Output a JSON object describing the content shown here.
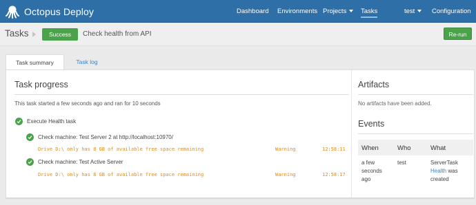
{
  "topbar": {
    "brand": "Octopus Deploy",
    "nav": {
      "dashboard": "Dashboard",
      "environments": "Environments",
      "projects": "Projects",
      "tasks": "Tasks",
      "user": "test",
      "configuration": "Configuration"
    }
  },
  "subheader": {
    "title": "Tasks",
    "status": "Success",
    "task_name": "Check health from API",
    "rerun_label": "Re-run"
  },
  "tabs": {
    "summary": "Task summary",
    "log": "Task log"
  },
  "progress": {
    "title": "Task progress",
    "summary": "This task started a few seconds ago and ran for 10 seconds",
    "root_step": "Execute Health task",
    "steps": [
      {
        "label": "Check machine: Test Server 2 at http://localhost:10970/",
        "log": {
          "message": "Drive D:\\ only has 8 GB of available free space remaining",
          "level": "Warning",
          "time": "12:58:11"
        }
      },
      {
        "label": "Check machine: Test Active Server",
        "log": {
          "message": "Drive D:\\ only has 8 GB of available free space remaining",
          "level": "Warning",
          "time": "12:58:17"
        }
      }
    ]
  },
  "artifacts": {
    "title": "Artifacts",
    "empty": "No artifacts have been added."
  },
  "events": {
    "title": "Events",
    "headers": {
      "when": "When",
      "who": "Who",
      "what": "What"
    },
    "rows": [
      {
        "when_1": "a few",
        "when_2": "seconds",
        "when_3": "ago",
        "who": "test",
        "what_1": "ServerTask",
        "what_link": "Health",
        "what_2": " was",
        "what_3": "created"
      }
    ]
  },
  "colors": {
    "nav_bg": "#2f6fa8",
    "success": "#4aa34a",
    "warning": "#e08a1a",
    "link": "#3a83c5"
  },
  "icons": {
    "brand": "octopus-logo-icon",
    "status": "check-circle-icon"
  }
}
